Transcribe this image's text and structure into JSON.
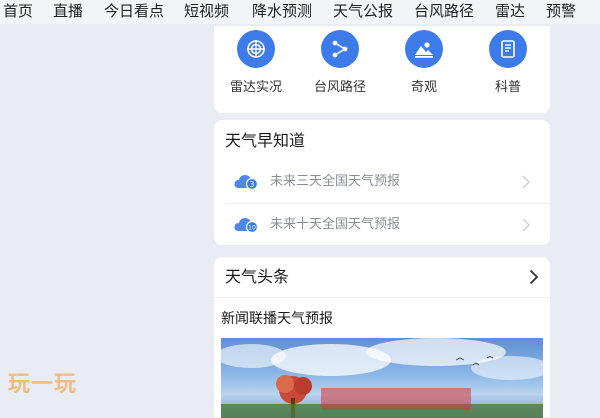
{
  "top_nav": {
    "items": [
      "首页",
      "直播",
      "今日看点",
      "短视频",
      "降水预测",
      "天气公报",
      "台风路径",
      "雷达",
      "预警"
    ]
  },
  "quick_access": {
    "items": [
      {
        "label": "雷达实况",
        "icon": "radar-icon"
      },
      {
        "label": "台风路径",
        "icon": "typhoon-path-icon"
      },
      {
        "label": "奇观",
        "icon": "landscape-icon"
      },
      {
        "label": "科普",
        "icon": "book-icon"
      }
    ]
  },
  "forecast_card": {
    "title": "天气早知道",
    "rows": [
      {
        "text": "未来三天全国天气预报",
        "icon": "cloud-3-icon",
        "badge": "3"
      },
      {
        "text": "未来十天全国天气预报",
        "icon": "cloud-10-icon",
        "badge": "10"
      }
    ]
  },
  "news_card": {
    "title": "天气头条",
    "headline": "新闻联播天气预报"
  },
  "watermark": "玩一玩",
  "colors": {
    "accent": "#3d7bea",
    "background": "#e9edf3",
    "card": "#ffffff",
    "muted_text": "#8a8f96"
  }
}
